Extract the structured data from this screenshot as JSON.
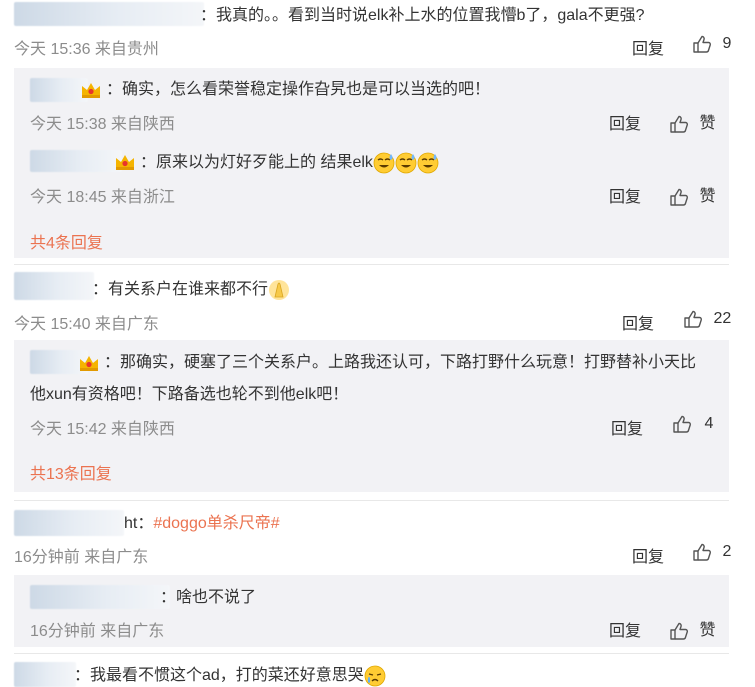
{
  "comments": [
    {
      "text": "：我真的。。看到当时说elk补上水的位置我懵b了，gala不更强?",
      "meta": "今天 15:36 来自贵州",
      "reply_label": "回复",
      "likes": "9",
      "replies": [
        {
          "text": "确实，怎么看荣誉稳定操作旮旯也是可以当选的吧！",
          "meta": "今天 15:38 来自陕西",
          "reply_label": "回复",
          "like_label": "赞"
        },
        {
          "text": "原来以为灯好歹能上的 结果elk",
          "meta": "今天 18:45 来自浙江",
          "reply_label": "回复",
          "like_label": "赞"
        }
      ],
      "more": "共4条回复"
    },
    {
      "text": "：有关系户在谁来都不行",
      "meta": "今天 15:40 来自广东",
      "reply_label": "回复",
      "likes": "22",
      "replies": [
        {
          "text_line1": "那确实，硬塞了三个关系户。上路我还认可，下路打野什么玩意！打野替补小天比",
          "text_line2": "他xun有资格吧！下路备选也轮不到他elk吧！",
          "meta": "今天 15:42 来自陕西",
          "reply_label": "回复",
          "likes": "4"
        }
      ],
      "more": "共13条回复"
    },
    {
      "text_prefix": "ht：",
      "hashtag": "#doggo单杀尺帝#",
      "meta": "16分钟前 来自广东",
      "reply_label": "回复",
      "likes": "2",
      "replies": [
        {
          "text": "：啥也不说了",
          "meta": "16分钟前 来自广东",
          "reply_label": "回复",
          "like_label": "赞"
        }
      ]
    },
    {
      "text": "：我最看不惯这个ad，打的菜还好意思哭"
    }
  ],
  "icons": {
    "like": "thumbs-up-icon",
    "vip": "crown-icon",
    "emoji_sweat": "sweat-smile-emoji-icon",
    "emoji_pray": "pray-emoji-icon",
    "emoji_cry": "cry-emoji-icon"
  },
  "colors": {
    "accent": "#eb7350",
    "meta": "#8c8c8c",
    "reply_bg": "#f2f2f5"
  }
}
